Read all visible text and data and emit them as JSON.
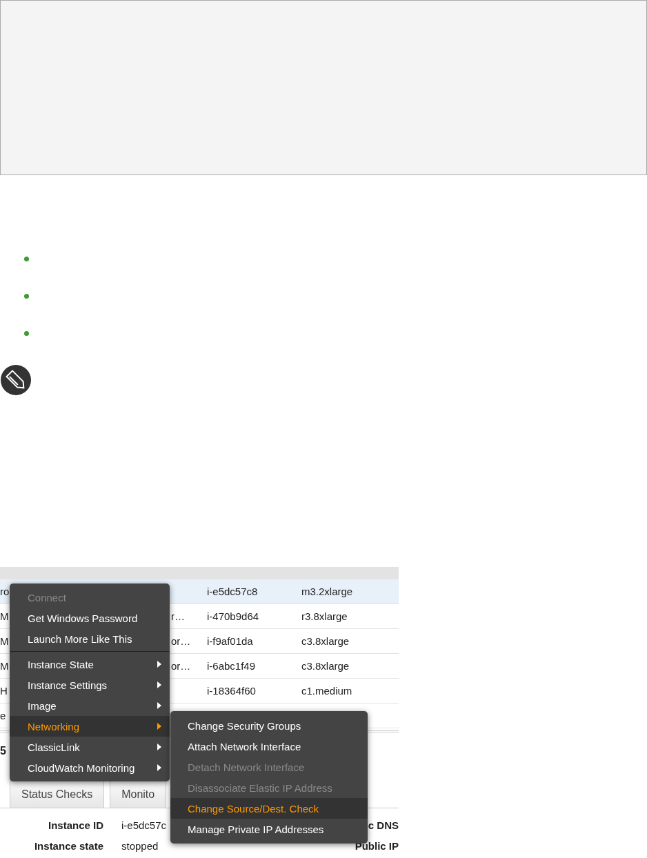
{
  "code_block": {
    "kind": "code"
  },
  "bullets": [
    {
      "kind": "bullet"
    },
    {
      "kind": "bullet"
    },
    {
      "kind": "bullet"
    }
  ],
  "note": {
    "kind": "note"
  },
  "screenshot": {
    "table": {
      "rows": [
        {
          "selected": true,
          "cells": [
            "ro",
            "",
            "i-e5dc57c8",
            "m3.2xlarge"
          ]
        },
        {
          "selected": false,
          "cells": [
            "M",
            "r…",
            "i-470b9d64",
            "r3.8xlarge"
          ]
        },
        {
          "selected": false,
          "cells": [
            "M",
            "or…",
            "i-f9af01da",
            "c3.8xlarge"
          ]
        },
        {
          "selected": false,
          "cells": [
            "M",
            "or…",
            "i-6abc1f49",
            "c3.8xlarge"
          ]
        },
        {
          "selected": false,
          "cells": [
            "H",
            "",
            "i-18364f60",
            "c1.medium"
          ]
        },
        {
          "selected": false,
          "cells": [
            "e",
            "",
            "",
            ""
          ]
        }
      ]
    },
    "instance_heading": "5",
    "tabs": [
      {
        "label": "Status Checks",
        "selected": false
      },
      {
        "label": "Monito",
        "selected": false
      }
    ],
    "details": [
      {
        "label": "Instance ID",
        "value": "i-e5dc57c",
        "label_2": "c DNS"
      },
      {
        "label": "Instance state",
        "value": "stopped",
        "label_2": "Public IP"
      }
    ],
    "context_menu": [
      {
        "kind": "item",
        "label": "Connect",
        "disabled": true,
        "selected": false,
        "submenu": false
      },
      {
        "kind": "item",
        "label": "Get Windows Password",
        "disabled": false,
        "selected": false,
        "submenu": false
      },
      {
        "kind": "item",
        "label": "Launch More Like This",
        "disabled": false,
        "selected": false,
        "submenu": false
      },
      {
        "kind": "separator"
      },
      {
        "kind": "item",
        "label": "Instance State",
        "disabled": false,
        "selected": false,
        "submenu": true
      },
      {
        "kind": "item",
        "label": "Instance Settings",
        "disabled": false,
        "selected": false,
        "submenu": true
      },
      {
        "kind": "item",
        "label": "Image",
        "disabled": false,
        "selected": false,
        "submenu": true
      },
      {
        "kind": "item",
        "label": "Networking",
        "disabled": false,
        "selected": true,
        "submenu": true
      },
      {
        "kind": "item",
        "label": "ClassicLink",
        "disabled": false,
        "selected": false,
        "submenu": true
      },
      {
        "kind": "item",
        "label": "CloudWatch Monitoring",
        "disabled": false,
        "selected": false,
        "submenu": true
      }
    ],
    "submenu": [
      {
        "label": "Change Security Groups",
        "disabled": false,
        "selected": false
      },
      {
        "label": "Attach Network Interface",
        "disabled": false,
        "selected": false
      },
      {
        "label": "Detach Network Interface",
        "disabled": true,
        "selected": false
      },
      {
        "label": "Disassociate Elastic IP Address",
        "disabled": true,
        "selected": false
      },
      {
        "label": "Change Source/Dest. Check",
        "disabled": false,
        "selected": true
      },
      {
        "label": "Manage Private IP Addresses",
        "disabled": false,
        "selected": false
      }
    ]
  }
}
